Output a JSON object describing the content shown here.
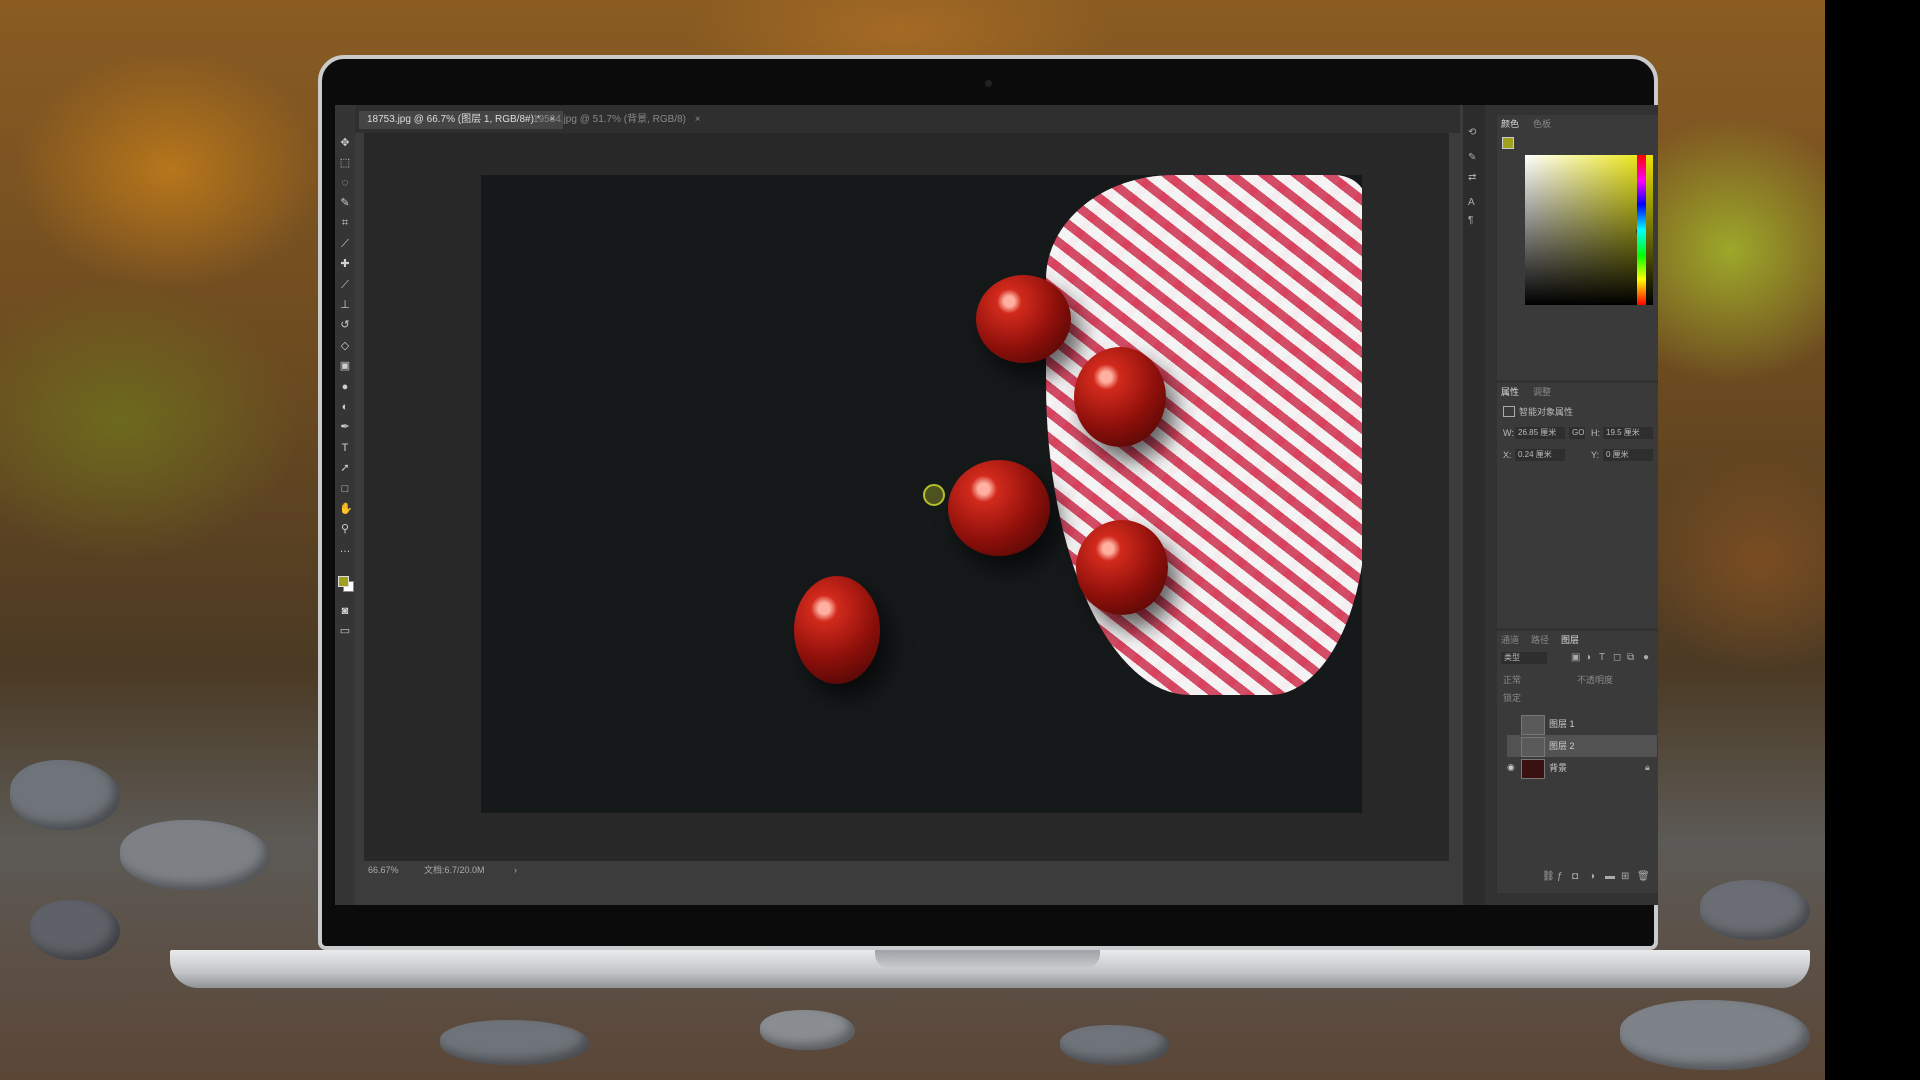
{
  "document_tabs": [
    {
      "label": "18753.jpg @ 66.7% (图层 1, RGB/8#) *",
      "active": true
    },
    {
      "label": "19564.jpg @ 51.7% (背景, RGB/8)",
      "active": false
    }
  ],
  "tab_close_symbol": "×",
  "status": {
    "zoom": "66.67%",
    "doc_info": "文档:6.7/20.0M"
  },
  "color_panel": {
    "tabs": [
      "颜色",
      "色板"
    ],
    "foreground": "#9fa21e",
    "background": "#ffffff"
  },
  "properties_panel": {
    "tabs": [
      "属性",
      "调整"
    ],
    "heading": "智能对象属性",
    "width_label": "W:",
    "width_value": "26.85 厘米",
    "link_label": "GO",
    "height_label": "H:",
    "height_value": "19.5 厘米",
    "x_label": "X:",
    "x_value": "0.24 厘米",
    "y_label": "Y:",
    "y_value": "0 厘米"
  },
  "layers_panel": {
    "tabs": [
      "通道",
      "路径",
      "图层"
    ],
    "filter_value": "类型",
    "blend_mode": "正常",
    "opacity_label": "不透明度",
    "lock_label": "锁定",
    "layers": [
      {
        "name": "图层 1",
        "visible": false,
        "selected": false
      },
      {
        "name": "图层 2",
        "visible": false,
        "selected": true
      },
      {
        "name": "背景",
        "visible": true,
        "selected": false,
        "locked": true
      }
    ]
  },
  "tools": [
    "move-icon",
    "marquee-icon",
    "lasso-icon",
    "quick-select-icon",
    "crop-icon",
    "eyedropper-icon",
    "healing-icon",
    "brush-icon",
    "stamp-icon",
    "history-brush-icon",
    "eraser-icon",
    "gradient-icon",
    "blur-icon",
    "dodge-icon",
    "pen-icon",
    "type-icon",
    "path-select-icon",
    "shape-icon",
    "hand-icon",
    "zoom-icon",
    "more-tools-icon"
  ]
}
